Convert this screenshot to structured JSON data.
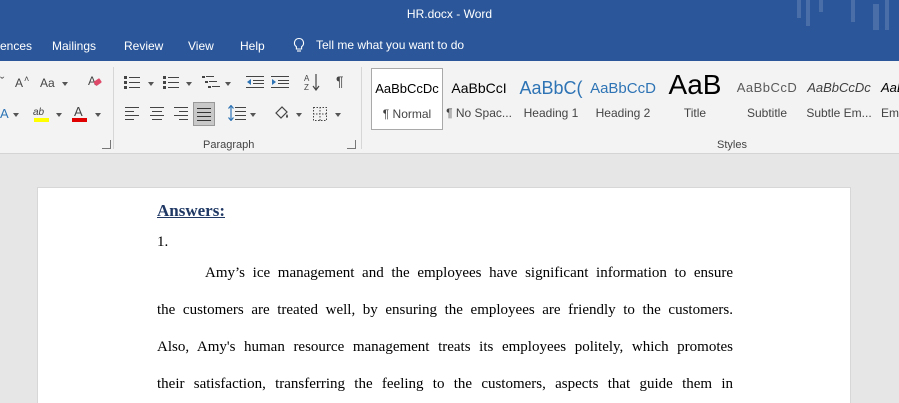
{
  "window": {
    "title": "HR.docx  -  Word"
  },
  "menu": {
    "tabs": [
      "ences",
      "Mailings",
      "Review",
      "View",
      "Help"
    ],
    "tell_me": "Tell me what you want to do"
  },
  "ribbon": {
    "paragraph_label": "Paragraph",
    "styles_label": "Styles",
    "font_partial": {
      "change_case": "Aa",
      "grow": "A",
      "highlight": "ab",
      "font_color": "A"
    },
    "styles": [
      {
        "preview": "AaBbCcDc",
        "name": "¶ Normal",
        "selected": true
      },
      {
        "preview": "AaBbCcI",
        "name": "¶ No Spac...",
        "selected": false
      },
      {
        "preview": "AaBbC(",
        "name": "Heading 1",
        "selected": false
      },
      {
        "preview": "AaBbCcD",
        "name": "Heading 2",
        "selected": false
      },
      {
        "preview": "AaB",
        "name": "Title",
        "selected": false
      },
      {
        "preview": "AaBbCcD",
        "name": "Subtitle",
        "selected": false
      },
      {
        "preview": "AaBbCcDc",
        "name": "Subtle Em...",
        "selected": false
      },
      {
        "preview": "AaBl",
        "name": "Em",
        "selected": false
      }
    ]
  },
  "document": {
    "heading": "Answers:",
    "item_number": "1.",
    "lines": [
      "Amy’s ice management and the employees have significant information to ensure",
      "the customers are treated well, by ensuring the employees are friendly to the customers.",
      "Also, Amy's human resource management treats its employees politely, which promotes",
      "their satisfaction, transferring the feeling to the customers, aspects that guide them in"
    ]
  },
  "colors": {
    "title_bar": "#2b579a",
    "heading_text": "#1f3864",
    "heading1_preview": "#2e74b5",
    "highlight_yellow": "#ffff00",
    "font_color_red": "#e00000"
  }
}
